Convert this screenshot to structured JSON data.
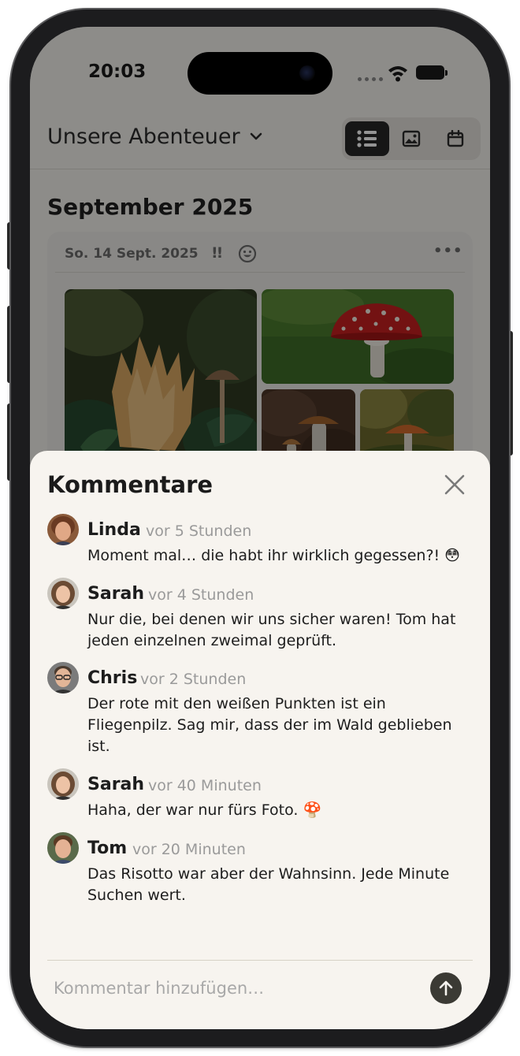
{
  "status_bar": {
    "time": "20:03"
  },
  "header": {
    "album_title": "Unsere Abenteuer",
    "view_modes": [
      "list-icon",
      "image-icon",
      "calendar-icon"
    ],
    "active_view": "list"
  },
  "timeline": {
    "month_heading": "September 2025",
    "entry": {
      "date": "So. 14 Sept. 2025",
      "priority_mark": "!!",
      "mood_icon": "smiley-icon",
      "more_label": "•••",
      "photos": [
        "coral-fungus-photo",
        "fly-agaric-photo",
        "brown-mushrooms-photo",
        "orange-mushroom-photo"
      ]
    }
  },
  "comments_sheet": {
    "title": "Kommentare",
    "close_icon": "close-icon",
    "comments": [
      {
        "author": "Linda",
        "time": "vor 5 Stunden",
        "text": "Moment mal… die habt ihr wirklich gegessen?! 😳"
      },
      {
        "author": "Sarah",
        "time": "vor 4 Stunden",
        "text": "Nur die, bei denen wir uns sicher waren! Tom hat jeden einzelnen zweimal geprüft."
      },
      {
        "author": "Chris",
        "time": "vor 2 Stunden",
        "text": "Der rote mit den weißen Punkten ist ein Fliegenpilz. Sag mir, dass der im Wald geblieben ist."
      },
      {
        "author": "Sarah",
        "time": "vor 40 Minuten",
        "text": "Haha, der war nur fürs Foto. 🍄"
      },
      {
        "author": "Tom",
        "time": "vor 20 Minuten",
        "text": "Das Risotto war aber der Wahnsinn. Jede Minute Suchen wert."
      }
    ],
    "input_placeholder": "Kommentar hinzufügen…",
    "send_icon": "arrow-up-icon"
  },
  "colors": {
    "sheet_background": "#f7f4ef",
    "send_button": "#3b3a34",
    "active_segment": "#262626"
  }
}
